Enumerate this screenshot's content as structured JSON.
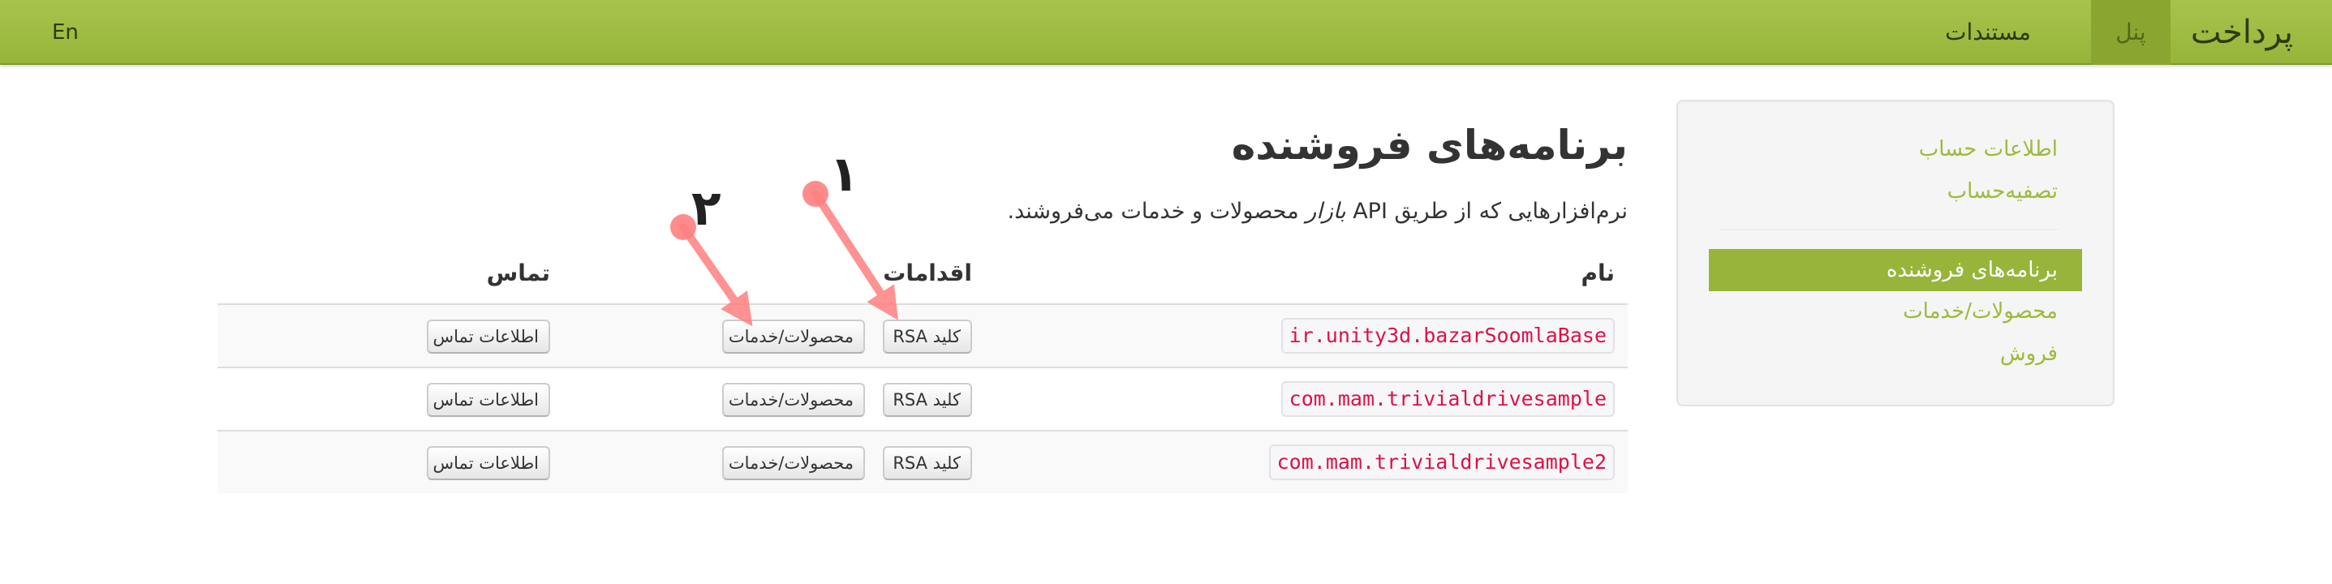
{
  "navbar": {
    "brand": "پرداخت",
    "items": [
      {
        "label": "پنل",
        "active": true
      },
      {
        "label": "مستندات",
        "active": false
      }
    ],
    "lang": "En"
  },
  "sidebar": {
    "items": [
      {
        "label": "اطلاعات حساب"
      },
      {
        "label": "تصفیه‌حساب"
      },
      {
        "label": "برنامه‌های فروشنده",
        "active": true
      },
      {
        "label": "محصولات/خدمات"
      },
      {
        "label": "فروش"
      }
    ]
  },
  "main": {
    "title": "برنامه‌های فروشنده",
    "description": {
      "prefix": "نرم‌افزارهایی که از طریق API",
      "emphasis": "بازار",
      "suffix": "محصولات و خدمات می‌فروشند."
    },
    "table": {
      "headers": {
        "name": "نام",
        "actions": "اقدامات",
        "contact": "تماس"
      },
      "rows": [
        {
          "package": "ir.unity3d.bazarSoomlaBase",
          "rsa": "کلید RSA",
          "products": "محصولات/خدمات",
          "contact": "اطلاعات تماس"
        },
        {
          "package": "com.mam.trivialdrivesample",
          "rsa": "کلید RSA",
          "products": "محصولات/خدمات",
          "contact": "اطلاعات تماس"
        },
        {
          "package": "com.mam.trivialdrivesample2",
          "rsa": "کلید RSA",
          "products": "محصولات/خدمات",
          "contact": "اطلاعات تماس"
        }
      ]
    }
  },
  "annotations": {
    "one": "۱",
    "two": "۲"
  },
  "colors": {
    "navbar": "#a0bd44",
    "accent": "#98b43a",
    "link": "#9cbb3a",
    "code": "#dd1144",
    "arrow": "#ff7f7f"
  }
}
